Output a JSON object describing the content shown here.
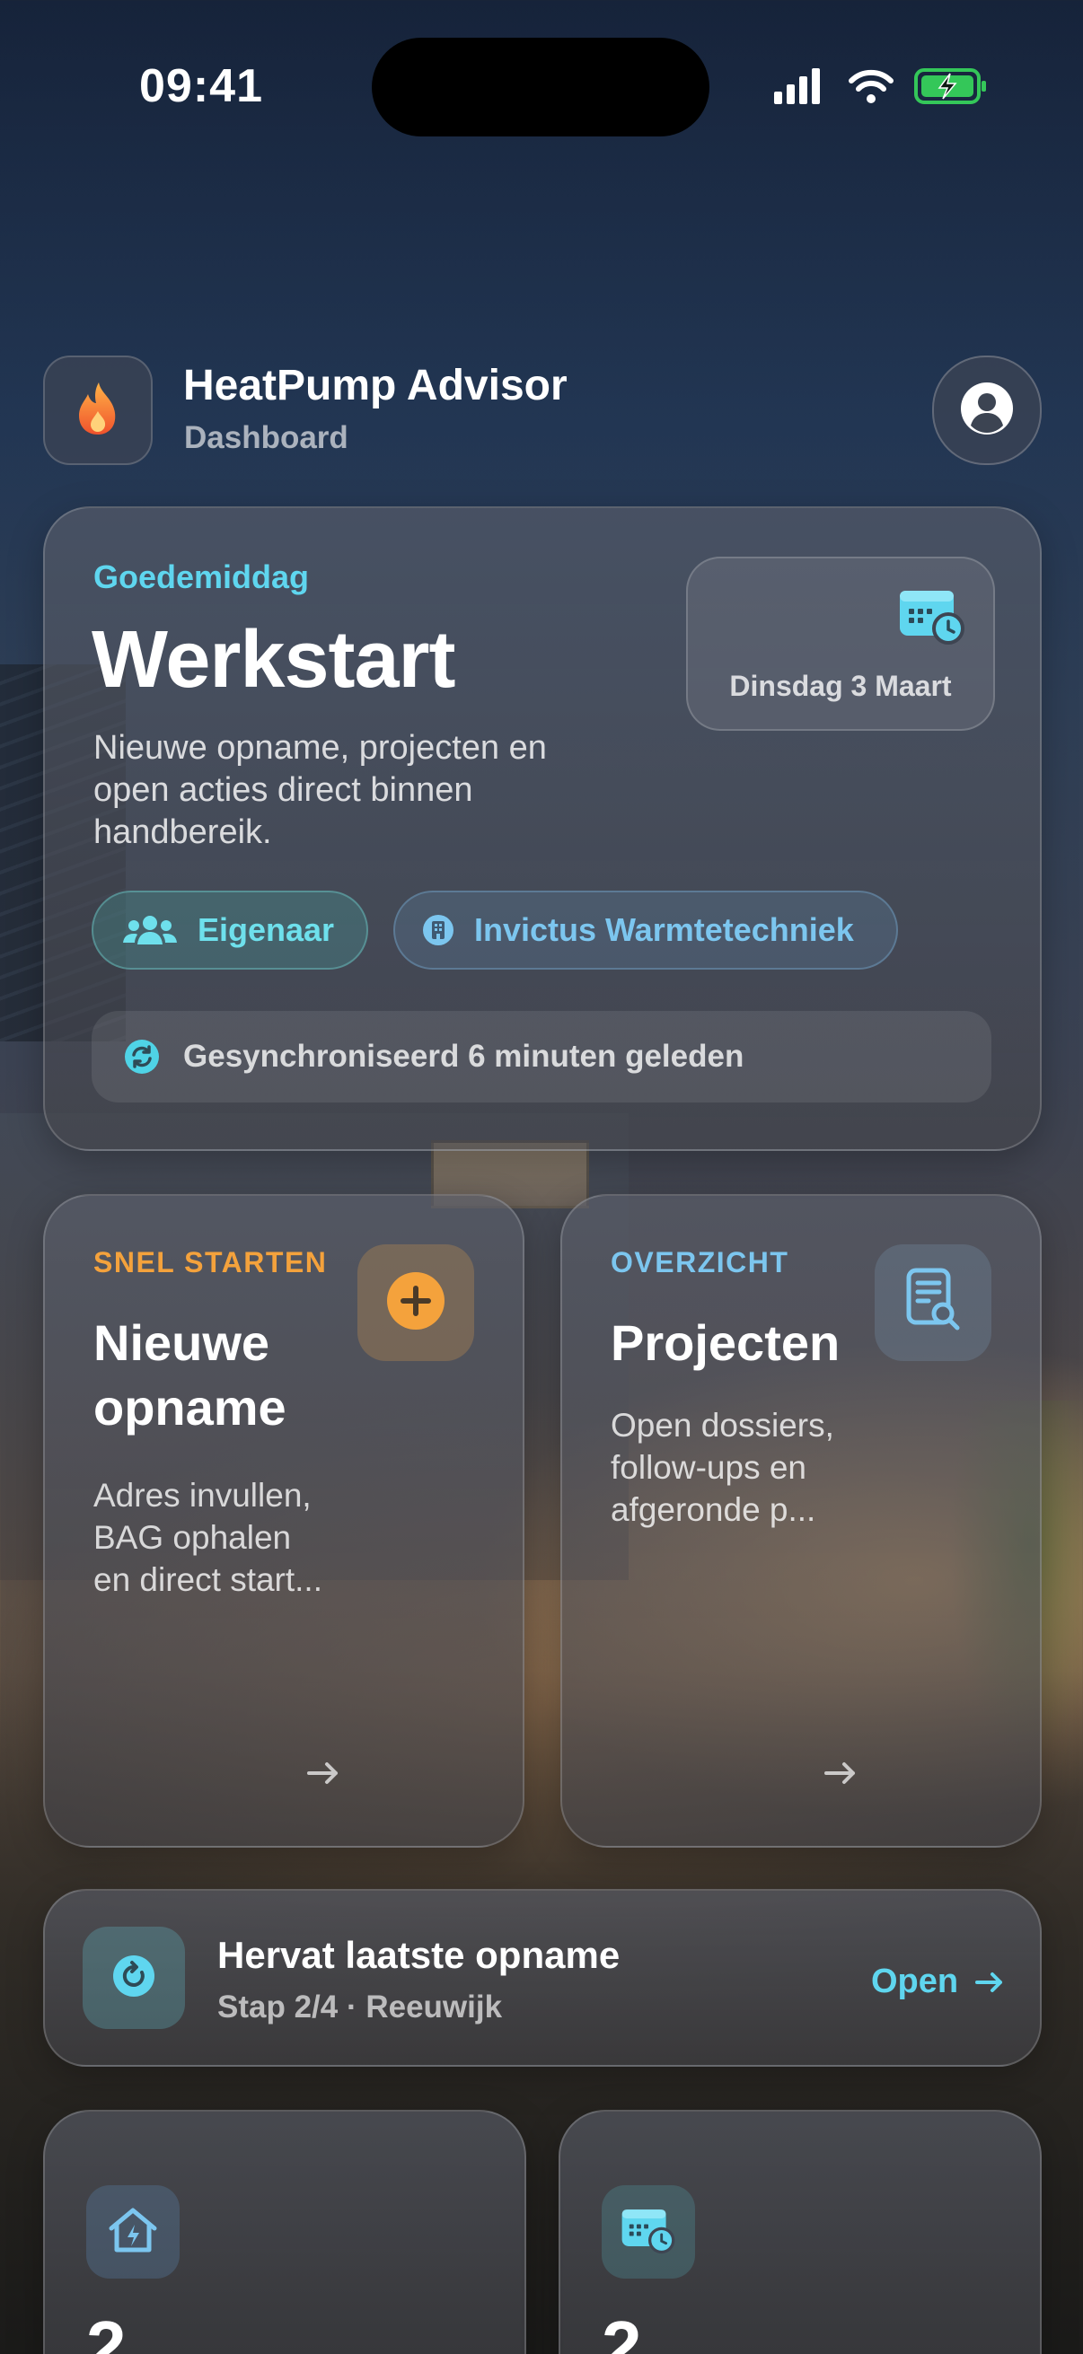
{
  "status_bar": {
    "time": "09:41"
  },
  "header": {
    "title": "HeatPump Advisor",
    "subtitle": "Dashboard"
  },
  "hero": {
    "greeting": "Goedemiddag",
    "title": "Werkstart",
    "description": "Nieuwe opname, projecten en open acties direct binnen handbereik.",
    "date": "Dinsdag 3 Maart",
    "role_chip": "Eigenaar",
    "company_chip": "Invictus Warmtetechniek",
    "sync_status": "Gesynchroniseerd 6 minuten geleden"
  },
  "tiles": {
    "new_survey": {
      "eyebrow": "SNEL STARTEN",
      "title": "Nieuwe opname",
      "description": "Adres invullen, BAG ophalen en direct start..."
    },
    "projects": {
      "eyebrow": "OVERZICHT",
      "title": "Projecten",
      "description": "Open dossiers, follow-ups en afgeronde p..."
    }
  },
  "resume": {
    "title": "Hervat laatste opname",
    "subtitle": "Stap 2/4 · Reeuwijk",
    "action": "Open"
  },
  "stats": {
    "houses_value": "2",
    "schedule_value": "2"
  },
  "icons": {
    "logo": "flame-icon",
    "profile": "user-circle-icon",
    "calendar": "calendar-clock-icon",
    "owner": "users-icon",
    "company": "building-icon",
    "sync": "sync-icon",
    "new_survey": "plus-circle-icon",
    "projects": "document-search-icon",
    "resume": "resume-icon",
    "houses": "house-bolt-icon",
    "schedule": "calendar-clock-icon"
  },
  "colors": {
    "accent_cyan": "#5fd6ef",
    "accent_orange": "#f4a23c",
    "company_blue": "#7cc6ef",
    "battery_green": "#34c759"
  }
}
